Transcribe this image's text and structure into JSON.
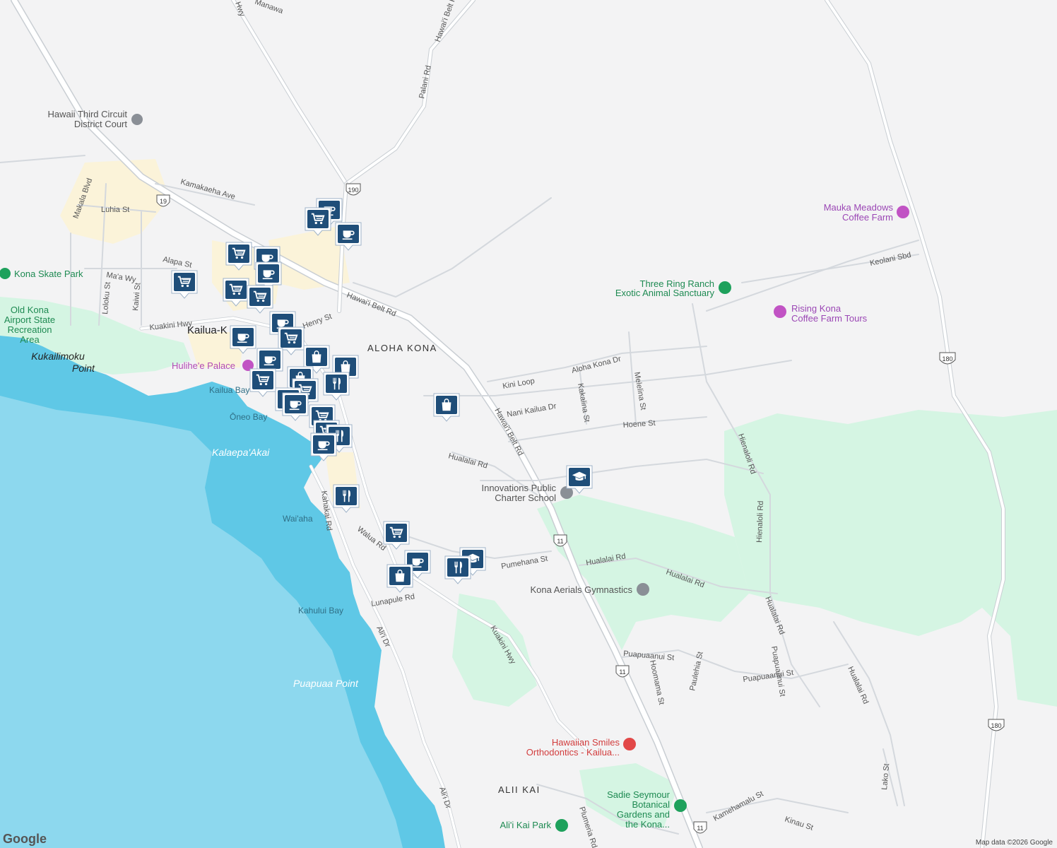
{
  "map": {
    "attribution": "Map data ©2026 Google",
    "logo": "Google",
    "colors": {
      "land": "#f3f3f4",
      "ocean": "#5fc8e6",
      "deep_ocean": "#8dd8ee",
      "park": "#d5f5e3",
      "green": "#cdeedb",
      "commercial": "#fbf3d9",
      "road": "#ffffff",
      "road_border": "#c9ced3"
    },
    "poi": {
      "court_line1": "Hawaii Third Circuit",
      "court_line2": "District Court",
      "skate_park": "Kona Skate Park",
      "old_kona1": "Old Kona",
      "old_kona2": "Airport State",
      "old_kona3": "Recreation",
      "old_kona4": "Area",
      "hulihee": "Hulihe'e Palace",
      "mauka1": "Mauka Meadows",
      "mauka2": "Coffee Farm",
      "threering1": "Three Ring Ranch",
      "threering2": "Exotic Animal Sanctuary",
      "rising1": "Rising Kona",
      "rising2": "Coffee Farm Tours",
      "innovations1": "Innovations Public",
      "innovations2": "Charter School",
      "aerials": "Kona Aerials Gymnastics",
      "smiles1": "Hawaiian Smiles",
      "smiles2": "Orthodontics - Kailua...",
      "sadie1": "Sadie Seymour",
      "sadie2": "Botanical",
      "sadie3": "Gardens and",
      "sadie4": "the Kona...",
      "aliikai_park": "Ali'i Kai Park"
    },
    "areas": {
      "aloha_kona": "ALOHA KONA",
      "alii_kai": "ALII KAI",
      "kailua": "Kailua-K"
    },
    "water": {
      "kailua_bay": "Kailua Bay",
      "oneo_bay": "Ōneo Bay",
      "kahului_bay": "Kahului Bay",
      "waiaha": "Wai'aha",
      "kalaepa": "Kalaepa'Akai",
      "puapuaa": "Puapuaa Point",
      "kukailimoku1": "Kukailimoku",
      "kukailimoku2": "Point"
    },
    "roads": {
      "palani": "Palani Rd",
      "belt1": "Hawai'i Belt Rd",
      "belt2": "Hawai'i Belt Rd",
      "belt3": "Hawai'i Belt Rd",
      "kamakaeha": "Kamakaeha Ave",
      "makala": "Makala Blvd",
      "luhia": "Luhia St",
      "alapa": "Alapa St",
      "maa": "Ma'a Wy",
      "loloku": "Loloku St",
      "kaiwi": "Kaiwi St",
      "kuakini1": "Kuakini Hwy",
      "kuakini2": "Kuakini Hwy",
      "henry": "Henry St",
      "kini": "Kini Loop",
      "alohakona": "Aloha Kona Dr",
      "nanikailua": "Nani Kailua Dr",
      "kakalina": "Kakalina St",
      "melelina": "Melelina St",
      "hoene": "Hoene St",
      "hienaloli1": "Hienaloli Rd",
      "hienaloli2": "Hienaloli Rd",
      "hualalai1": "Hualalai Rd",
      "hualalai2": "Hualalai Rd",
      "hualalai3": "Hualalai Rd",
      "hualalai4": "Hualalai Rd",
      "hualalai5": "Hualalai Rd",
      "pumehana": "Pumehana St",
      "walua": "Walua Rd",
      "kahakai": "Kahakai Rd",
      "lunapule": "Lunapule Rd",
      "alii1": "Ali'i Dr",
      "alii2": "Ali'i Dr",
      "puapuaanui1": "Puapuaanui St",
      "puapuaanui2": "Puapuaanui St",
      "hoomama": "Hoomama St",
      "paulehia": "Paulehia St",
      "keolani": "Keolani Sbd",
      "kamehamalu": "Kamehamalu St",
      "kinau": "Kinau St",
      "plumeria": "Plumeria Rd",
      "lako": "Lako St",
      "manawa": "Manawa",
      "hwy": "Hwy"
    },
    "shields": {
      "s190": "190",
      "s19": "19",
      "s11a": "11",
      "s11b": "11",
      "s11c": "11",
      "s180a": "180",
      "s180b": "180"
    },
    "markers": [
      {
        "kind": "grocery",
        "icon": "cart-icon"
      },
      {
        "kind": "cafe",
        "icon": "coffee-cup-icon"
      },
      {
        "kind": "shopping",
        "icon": "shopping-bag-icon"
      },
      {
        "kind": "restaurant",
        "icon": "fork-knife-icon"
      },
      {
        "kind": "school",
        "icon": "graduation-cap-icon"
      }
    ]
  }
}
